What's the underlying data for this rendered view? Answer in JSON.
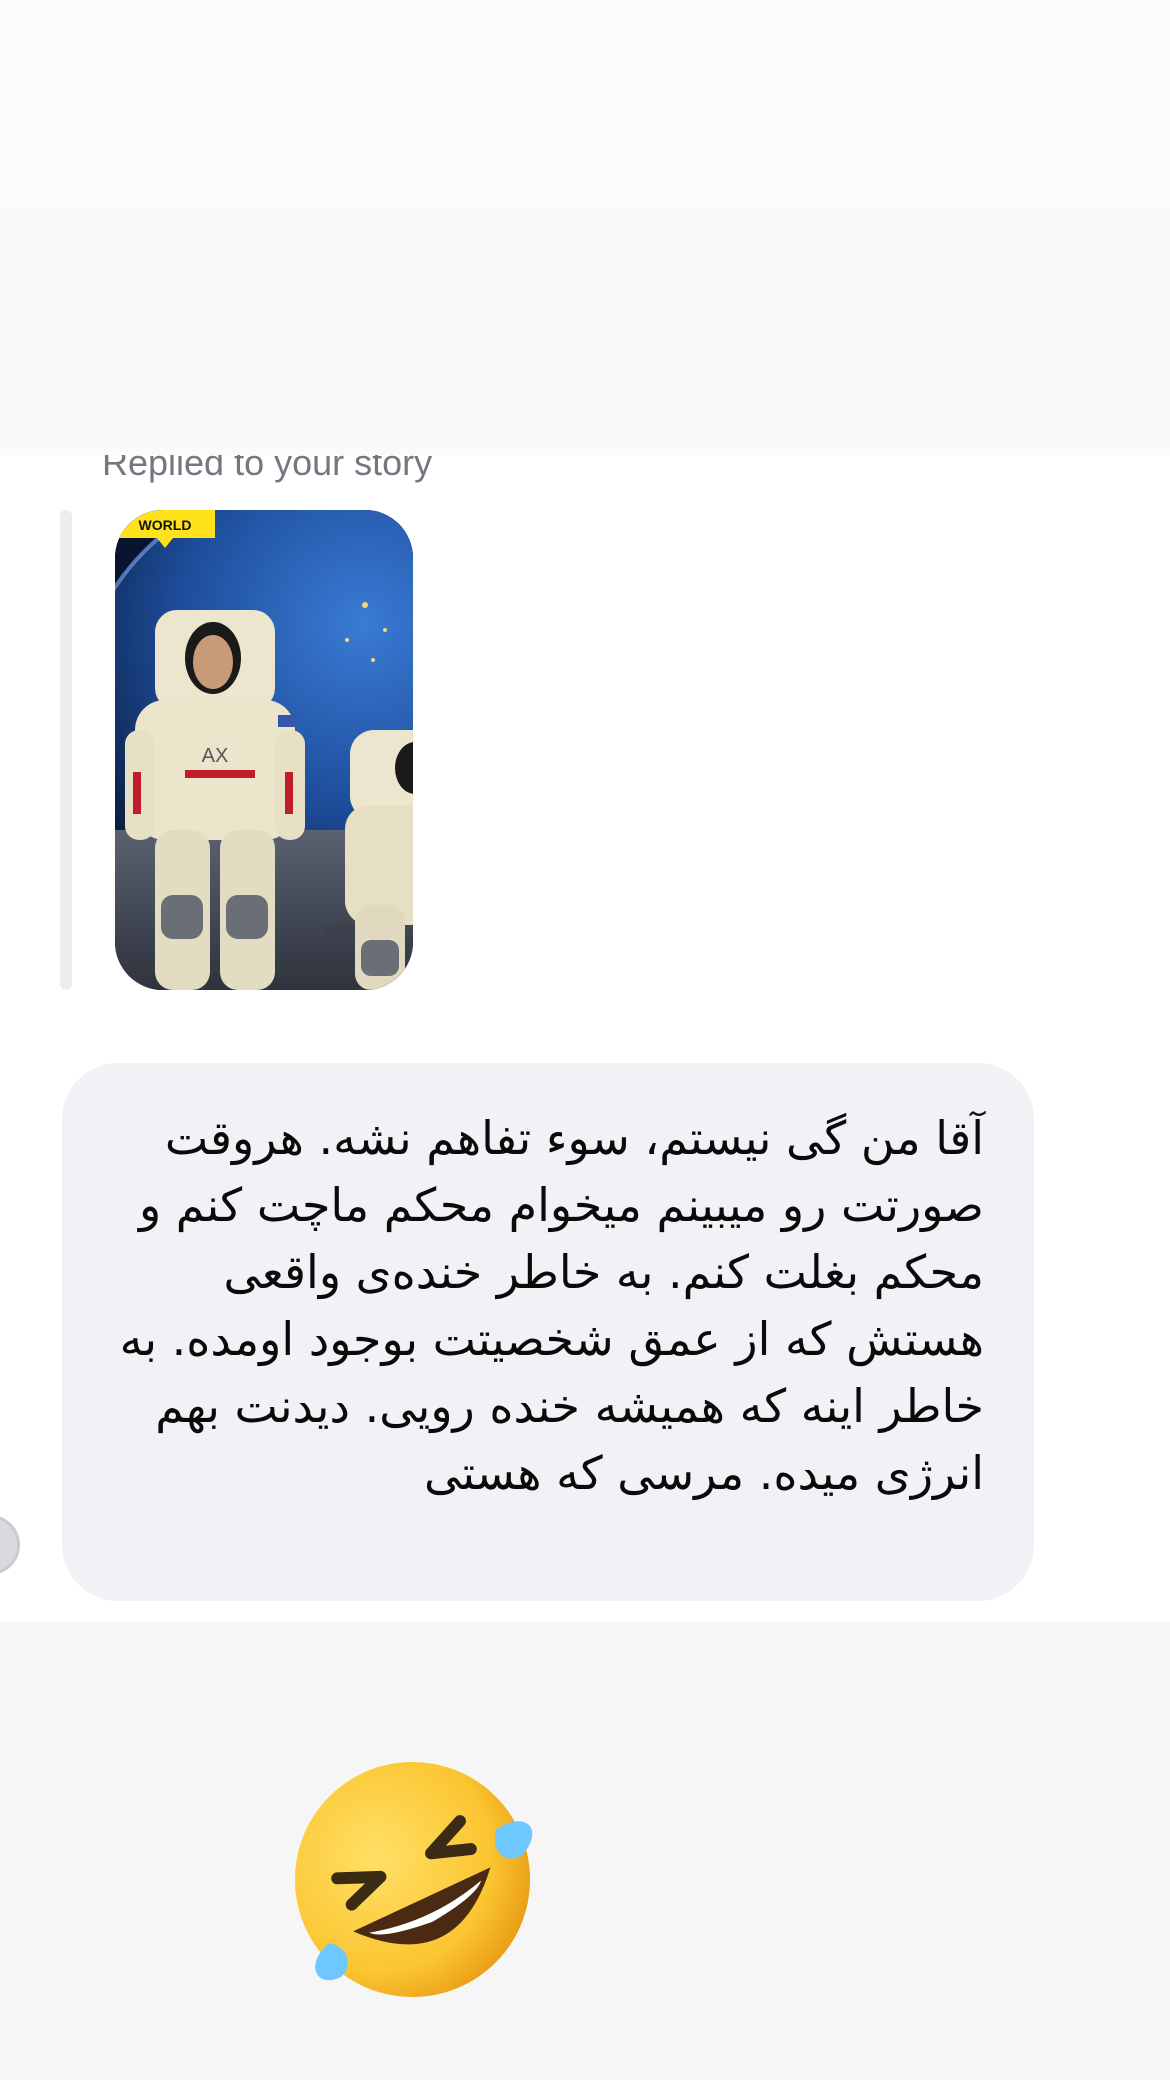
{
  "reply": {
    "label": "Replied to your story",
    "story_badge": "WORLD",
    "story_caption": "AX"
  },
  "message": {
    "text": "آقا من گی نیستم، سوء تفاهم نشه. هروقت صورتت رو میبینم میخوام محکم ماچت کنم و محکم بغلت کنم. به خاطر خنده‌ی واقعی هستش که از عمق شخصیتت بوجود اومده. به خاطر اینه که همیشه خنده رویی. دیدنت بهم انرژی میده. مرسی که هستی"
  },
  "reaction": {
    "emoji_name": "rolling-on-the-floor-laughing-icon",
    "accent": "#ffcc33"
  }
}
